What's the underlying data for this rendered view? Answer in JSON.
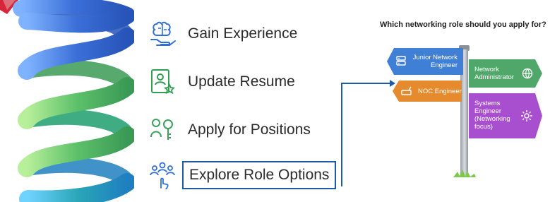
{
  "steps": [
    {
      "label": "Gain Experience",
      "icon": "brain-hand-icon"
    },
    {
      "label": "Update Resume",
      "icon": "resume-star-icon"
    },
    {
      "label": "Apply for Positions",
      "icon": "people-key-icon"
    },
    {
      "label": "Explore Role Options",
      "icon": "team-pointer-icon"
    }
  ],
  "signpost": {
    "question": "Which networking role should you apply for?",
    "signs": [
      {
        "line1": "Junior Network",
        "line2": "Engineer",
        "icon": "server-icon",
        "color": "#3f7fd6"
      },
      {
        "line1": "NOC Engineer",
        "icon": "router-icon",
        "color": "#e68a2e"
      },
      {
        "line1": "Network",
        "line2": "Administrator",
        "icon": "globe-gear-icon",
        "color": "#4fa86a"
      },
      {
        "line1": "Systems",
        "line2": "Engineer",
        "line3": "(Networking",
        "line4": "focus)",
        "icon": "gear-cycle-icon",
        "color": "#a84fd0"
      }
    ]
  },
  "colors": {
    "spiral_blue": "#3b6fd8",
    "spiral_green": "#5cc06a",
    "spiral_teal": "#2aa6b8",
    "accent": "#1f5aa6",
    "badge": "#d6263a"
  }
}
